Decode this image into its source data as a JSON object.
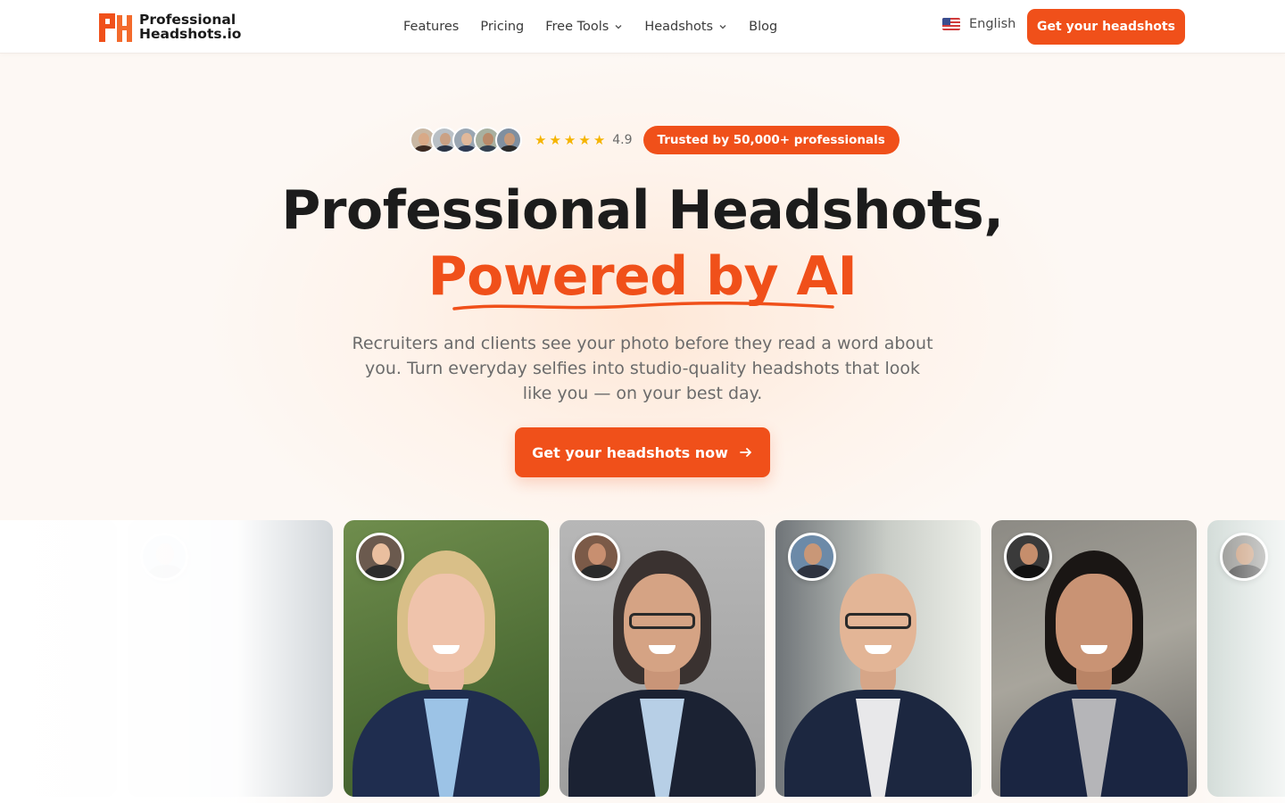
{
  "header": {
    "logo_line1": "Professional",
    "logo_line2": "Headshots.io",
    "nav": [
      {
        "label": "Features",
        "dropdown": false
      },
      {
        "label": "Pricing",
        "dropdown": false
      },
      {
        "label": "Free Tools",
        "dropdown": true
      },
      {
        "label": "Headshots",
        "dropdown": true
      },
      {
        "label": "Blog",
        "dropdown": false
      }
    ],
    "language": "English",
    "cta_label": "Get your headshots"
  },
  "hero": {
    "rating": "4.9",
    "stars": 5,
    "trusted_label": "Trusted by 50,000+ professionals",
    "title_line1": "Professional Headshots,",
    "title_line2": "Powered by AI",
    "subtitle": "Recruiters and clients see your photo before they read a word about you. Turn everyday selfies into studio-quality headshots that look like you — on your best day.",
    "cta_label": "Get your headshots now"
  },
  "colors": {
    "accent": "#f0501a",
    "star": "#f5b400",
    "text_dark": "#1c1c1c",
    "text_muted": "#6b6b6b"
  },
  "icons": [
    "logo-icon",
    "chevron-down-icon",
    "us-flag-icon",
    "star-icon",
    "arrow-right-icon"
  ]
}
